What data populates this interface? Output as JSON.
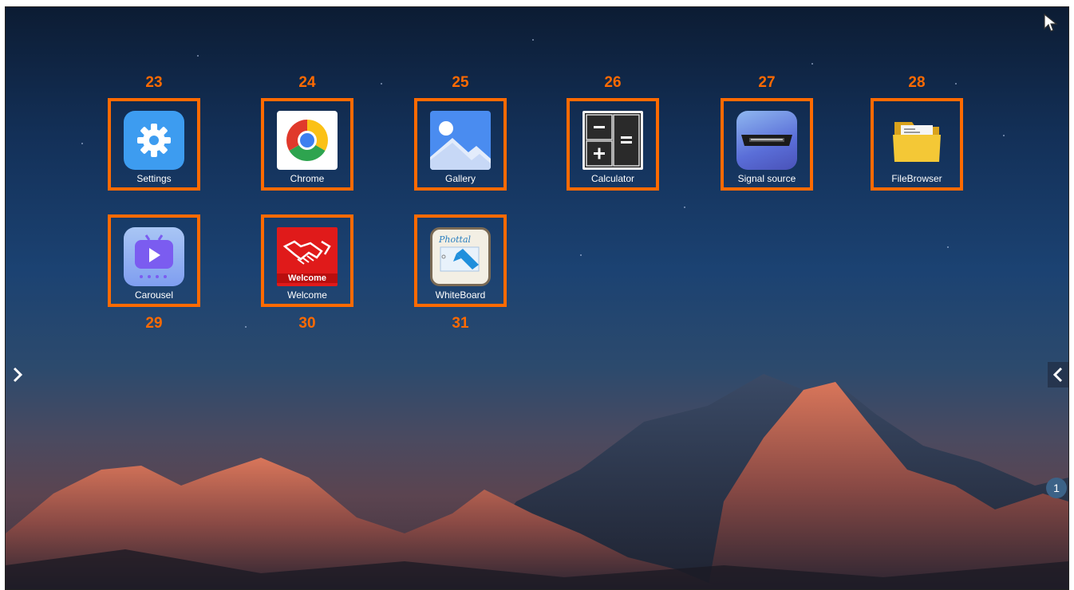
{
  "apps": [
    {
      "number": "23",
      "label": "Settings",
      "icon": "gear-icon",
      "color": "#3d9cf0"
    },
    {
      "number": "24",
      "label": "Chrome",
      "icon": "chrome-icon",
      "color": "#ffffff"
    },
    {
      "number": "25",
      "label": "Gallery",
      "icon": "gallery-icon",
      "color": "#4a8cf0"
    },
    {
      "number": "26",
      "label": "Calculator",
      "icon": "calculator-icon",
      "color": "#111111"
    },
    {
      "number": "27",
      "label": "Signal source",
      "icon": "hdmi-icon",
      "color": "#5a6ed8"
    },
    {
      "number": "28",
      "label": "FileBrowser",
      "icon": "folder-icon",
      "color": "#f2c230"
    },
    {
      "number": "29",
      "label": "Carousel",
      "icon": "tv-play-icon",
      "color": "#7b5cf0"
    },
    {
      "number": "30",
      "label": "Welcome",
      "icon": "handshake-icon",
      "color": "#e01a1a",
      "icon_text": "Welcome"
    },
    {
      "number": "31",
      "label": "WhiteBoard",
      "icon": "whiteboard-icon",
      "color": "#f3efe4",
      "icon_text": "Phottal"
    }
  ],
  "pager": {
    "current_page": "1"
  },
  "colors": {
    "highlight": "#ff6a00",
    "label": "#ffffff"
  }
}
